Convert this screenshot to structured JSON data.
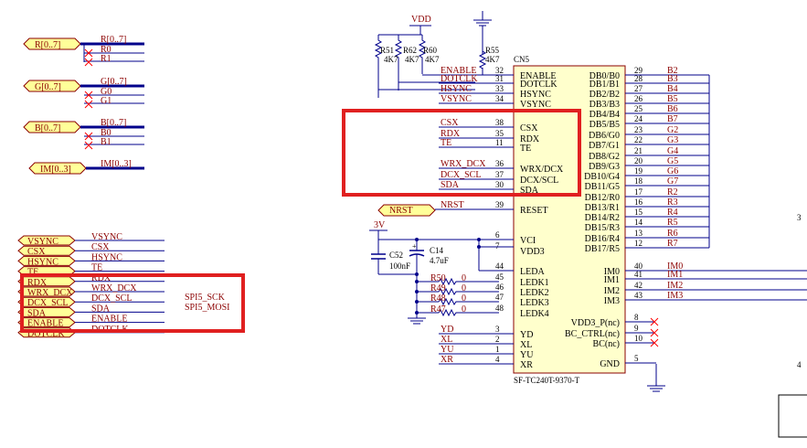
{
  "ports_top": [
    "R[0..7]",
    "G[0..7]",
    "B[0..7]",
    "IM[0..3]"
  ],
  "bus_left": [
    {
      "bus": "R[0..7]",
      "nets": [
        "R0",
        "R1"
      ]
    },
    {
      "bus": "G[0..7]",
      "nets": [
        "G0",
        "G1"
      ]
    },
    {
      "bus": "B[0..7]",
      "nets": [
        "B0",
        "B1"
      ]
    },
    {
      "bus": "IM[0..3]",
      "nets": []
    }
  ],
  "left_ports": [
    {
      "port": "VSYNC",
      "net": "VSYNC"
    },
    {
      "port": "CSX",
      "net": "CSX"
    },
    {
      "port": "HSYNC",
      "net": "HSYNC"
    },
    {
      "port": "TE",
      "net": "TE"
    },
    {
      "port": "RDX",
      "net": "RDX"
    },
    {
      "port": "WRX_DCX",
      "net": "WRX_DCX"
    },
    {
      "port": "DCX_SCL",
      "net": "DCX_SCL"
    },
    {
      "port": "SDA",
      "net": "SDA"
    },
    {
      "port": "ENABLE",
      "net": "ENABLE"
    },
    {
      "port": "DOTCLK",
      "net": "DOTCLK"
    }
  ],
  "spi_labels": [
    "SPI5_SCK",
    "SPI5_MOSI"
  ],
  "vdd_label": "VDD",
  "v3_label": "3V",
  "resistors": [
    {
      "ref": "R51",
      "value": "4K7"
    },
    {
      "ref": "R62",
      "value": "4K7"
    },
    {
      "ref": "R60",
      "value": "4K7"
    },
    {
      "ref": "R55",
      "value": "4K7"
    }
  ],
  "caps": [
    {
      "ref": "C52",
      "value": "100nF"
    },
    {
      "ref": "C14",
      "value": "4.7uF"
    }
  ],
  "led_resistors": [
    {
      "ref": "R50",
      "value": "0"
    },
    {
      "ref": "R49",
      "value": "0"
    },
    {
      "ref": "R48",
      "value": "0"
    },
    {
      "ref": "R47",
      "value": "0"
    }
  ],
  "nrst_label": "NRST",
  "connector": {
    "ref": "CN5",
    "part": "SF-TC240T-9370-T",
    "left_pins": [
      {
        "net": "ENABLE",
        "num": "32",
        "name": "ENABLE"
      },
      {
        "net": "DOTCLK",
        "num": "31",
        "name": "DOTCLK"
      },
      {
        "net": "HSYNC",
        "num": "33",
        "name": "HSYNC"
      },
      {
        "net": "VSYNC",
        "num": "34",
        "name": "VSYNC"
      },
      {
        "net": "CSX",
        "num": "38",
        "name": "CSX"
      },
      {
        "net": "RDX",
        "num": "35",
        "name": "RDX"
      },
      {
        "net": "TE",
        "num": "11",
        "name": "TE"
      },
      {
        "net": "WRX_DCX",
        "num": "36",
        "name": "WRX/DCX"
      },
      {
        "net": "DCX_SCL",
        "num": "37",
        "name": "DCX/SCL"
      },
      {
        "net": "SDA",
        "num": "30",
        "name": "SDA"
      },
      {
        "net": "NRST",
        "num": "39",
        "name": "RESET"
      },
      {
        "net": "",
        "num": "6",
        "name": "VCI"
      },
      {
        "net": "",
        "num": "7",
        "name": "VDD3"
      },
      {
        "net": "",
        "num": "44",
        "name": "LEDA"
      },
      {
        "net": "",
        "num": "45",
        "name": "LEDK1"
      },
      {
        "net": "",
        "num": "46",
        "name": "LEDK2"
      },
      {
        "net": "",
        "num": "47",
        "name": "LEDK3"
      },
      {
        "net": "",
        "num": "48",
        "name": "LEDK4"
      },
      {
        "net": "YD",
        "num": "3",
        "name": "YD"
      },
      {
        "net": "XL",
        "num": "2",
        "name": "XL"
      },
      {
        "net": "YU",
        "num": "1",
        "name": "YU"
      },
      {
        "net": "XR",
        "num": "4",
        "name": "XR"
      }
    ],
    "right_pins": [
      {
        "name": "DB0/B0",
        "num": "29",
        "net": "B2"
      },
      {
        "name": "DB1/B1",
        "num": "28",
        "net": "B3"
      },
      {
        "name": "DB2/B2",
        "num": "27",
        "net": "B4"
      },
      {
        "name": "DB3/B3",
        "num": "26",
        "net": "B5"
      },
      {
        "name": "DB4/B4",
        "num": "25",
        "net": "B6"
      },
      {
        "name": "DB5/B5",
        "num": "24",
        "net": "B7"
      },
      {
        "name": "DB6/G0",
        "num": "23",
        "net": "G2"
      },
      {
        "name": "DB7/G1",
        "num": "22",
        "net": "G3"
      },
      {
        "name": "DB8/G2",
        "num": "21",
        "net": "G4"
      },
      {
        "name": "DB9/G3",
        "num": "20",
        "net": "G5"
      },
      {
        "name": "DB10/G4",
        "num": "19",
        "net": "G6"
      },
      {
        "name": "DB11/G5",
        "num": "18",
        "net": "G7"
      },
      {
        "name": "DB12/R0",
        "num": "17",
        "net": "R2"
      },
      {
        "name": "DB13/R1",
        "num": "16",
        "net": "R3"
      },
      {
        "name": "DB14/R2",
        "num": "15",
        "net": "R4"
      },
      {
        "name": "DB15/R3",
        "num": "14",
        "net": "R5"
      },
      {
        "name": "DB16/R4",
        "num": "13",
        "net": "R6"
      },
      {
        "name": "DB17/R5",
        "num": "12",
        "net": "R7"
      },
      {
        "name": "IM0",
        "num": "40",
        "net": "IM0"
      },
      {
        "name": "IM1",
        "num": "41",
        "net": "IM1"
      },
      {
        "name": "IM2",
        "num": "42",
        "net": "IM2"
      },
      {
        "name": "IM3",
        "num": "43",
        "net": "IM3"
      },
      {
        "name": "VDD3_P(nc)",
        "num": "8",
        "net": ""
      },
      {
        "name": "BC_CTRL(nc)",
        "num": "9",
        "net": ""
      },
      {
        "name": "BC(nc)",
        "num": "10",
        "net": ""
      },
      {
        "name": "GND",
        "num": "5",
        "net": ""
      }
    ]
  },
  "colors": {
    "wire": "#00008b",
    "bus": "#00008b",
    "net": "#8b0000",
    "port_fill": "#ffff99",
    "highlight": "#e02020",
    "nc": "#ff0000"
  }
}
